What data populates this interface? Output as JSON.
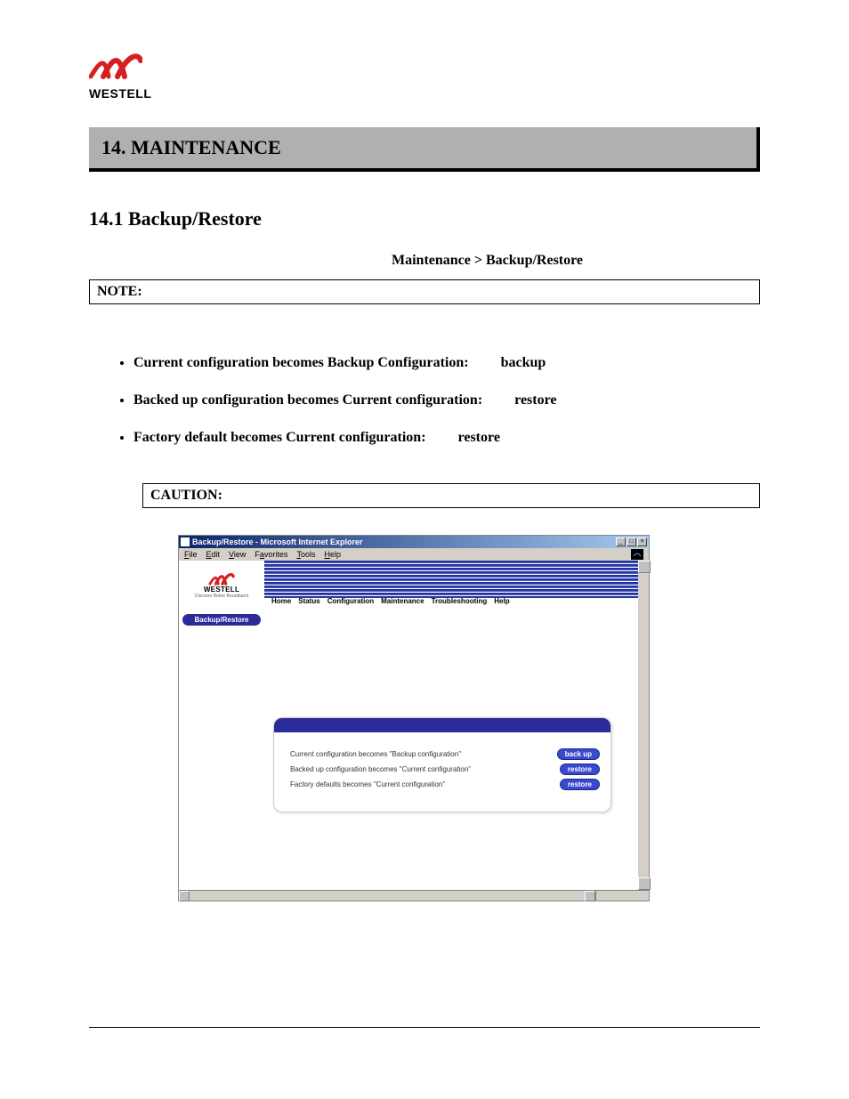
{
  "logo": {
    "brand": "WESTELL"
  },
  "section_heading": "14.  MAINTENANCE",
  "subsection_heading": "14.1 Backup/Restore",
  "breadcrumb": "Maintenance > Backup/Restore",
  "note_label": "NOTE:",
  "bullets": [
    {
      "text": "Current configuration becomes Backup Configuration:",
      "action": "backup"
    },
    {
      "text": "Backed up configuration becomes Current configuration:",
      "action": "restore"
    },
    {
      "text": "Factory default becomes Current configuration:",
      "action": "restore"
    }
  ],
  "caution_label": "CAUTION:",
  "ie": {
    "title": "Backup/Restore - Microsoft Internet Explorer",
    "menu": {
      "file": "File",
      "edit": "Edit",
      "view": "View",
      "favorites": "Favorites",
      "tools": "Tools",
      "help": "Help"
    },
    "winbtn": {
      "min": "_",
      "max": "□",
      "close": "×"
    }
  },
  "web": {
    "brand": "WESTELL",
    "tagline": "Discover Better Broadband",
    "nav": {
      "home": "Home",
      "status": "Status",
      "configuration": "Configuration",
      "maintenance": "Maintenance",
      "troubleshooting": "Troubleshooting",
      "help": "Help"
    },
    "sidebar_tab": "Backup/Restore",
    "rows": [
      {
        "text": "Current configuration becomes \"Backup configuration\"",
        "btn": "back up"
      },
      {
        "text": "Backed up configuration becomes \"Current configuration\"",
        "btn": "restore"
      },
      {
        "text": "Factory defaults becomes \"Current configuration\"",
        "btn": "restore"
      }
    ]
  }
}
